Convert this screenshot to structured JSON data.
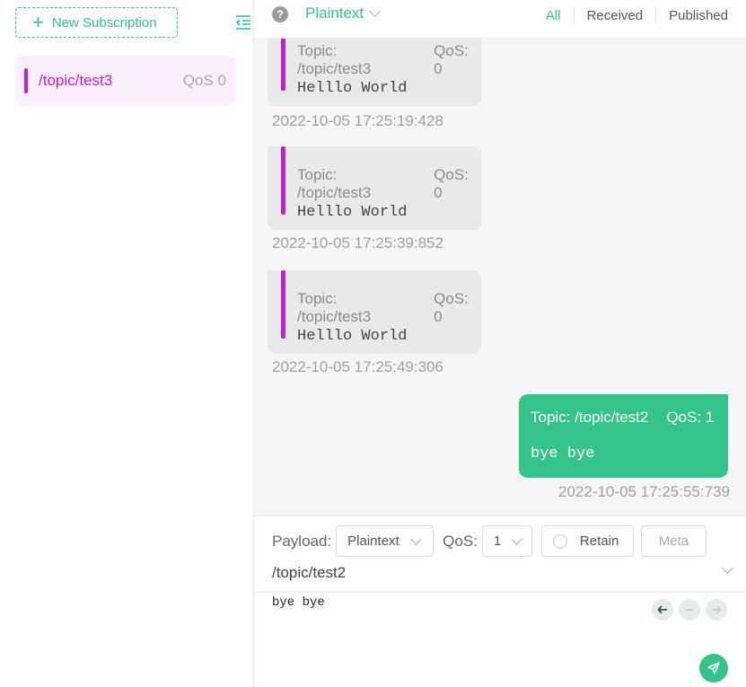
{
  "left_panel": {
    "new_subscription_label": "New Subscription",
    "subscriptions": [
      {
        "topic": "/topic/test3",
        "qos": "QoS 0",
        "color": "#c31fd1"
      }
    ]
  },
  "topbar": {
    "help_icon": "?",
    "payload_type": "Plaintext",
    "filters": [
      "All",
      "Received",
      "Published"
    ],
    "active_filter": "All"
  },
  "messages": [
    {
      "topic": "Topic: /topic/test3",
      "qos": "QoS: 0",
      "payload": "Helllo World",
      "timestamp": "2022-10-05 17:25:19:428"
    },
    {
      "topic": "Topic: /topic/test3",
      "qos": "QoS: 0",
      "payload": "Helllo World",
      "timestamp": "2022-10-05 17:25:39:852"
    },
    {
      "topic": "Topic: /topic/test3",
      "qos": "QoS: 0",
      "payload": "Helllo World",
      "timestamp": "2022-10-05 17:25:49:306"
    },
    {
      "topic": "Topic: /topic/test2",
      "qos": "QoS: 1",
      "payload": "bye bye",
      "timestamp": "2022-10-05 17:25:55:739"
    }
  ],
  "composer": {
    "payload_label": "Payload:",
    "payload_format": "Plaintext",
    "qos_label": "QoS:",
    "qos_value": "1",
    "retain_label": "Retain",
    "meta_label": "Meta",
    "topic": "/topic/test2",
    "payload": "bye bye"
  },
  "colors": {
    "accent": "#34c388",
    "subscription": "#c31fd1"
  }
}
